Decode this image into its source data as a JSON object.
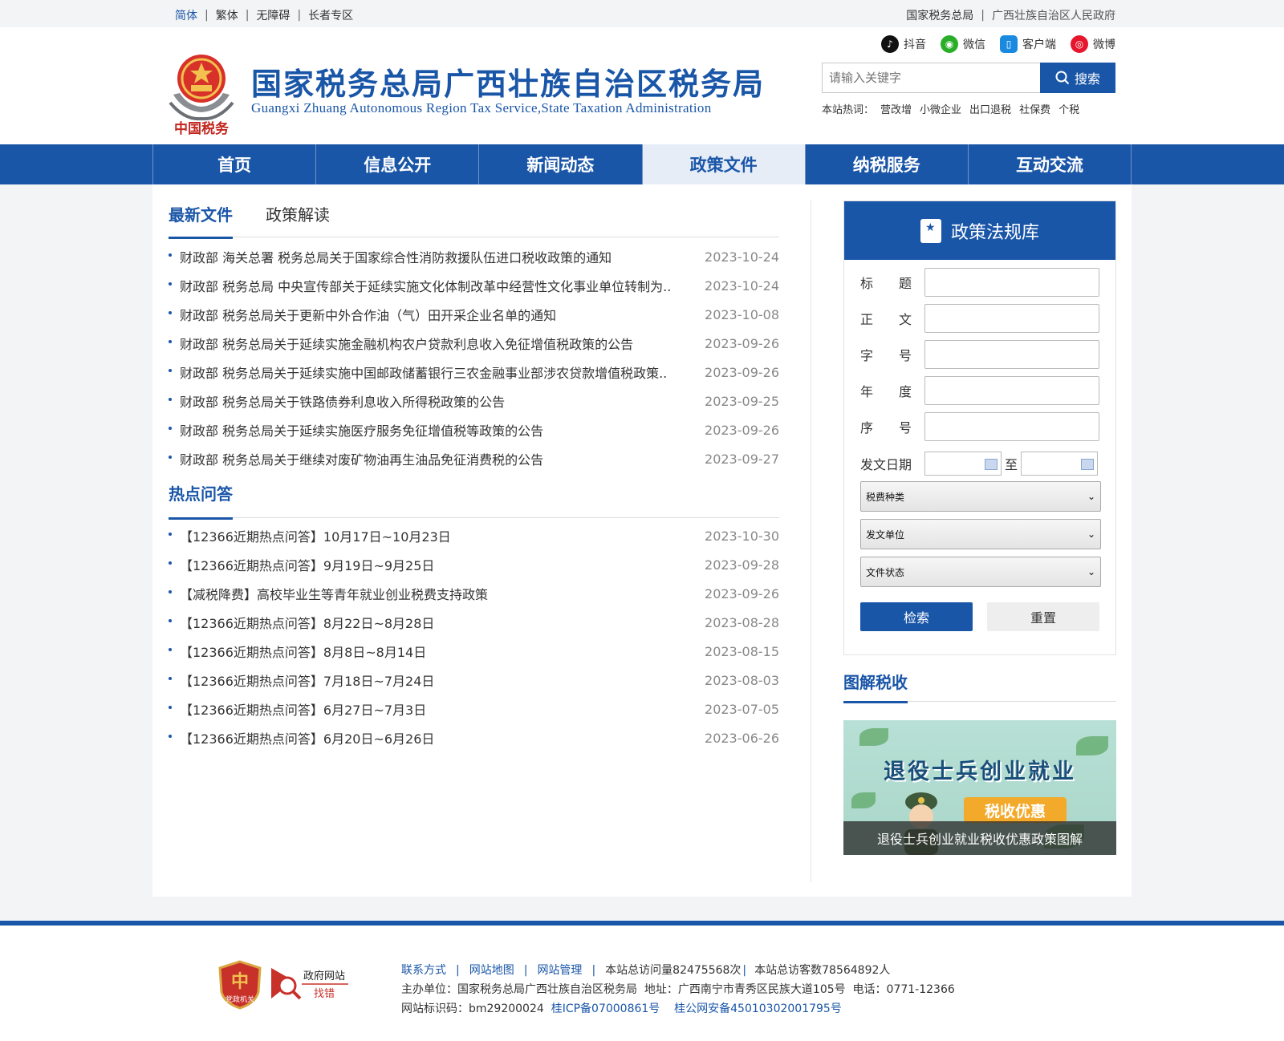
{
  "topbar": {
    "left": [
      "简体",
      "繁体",
      "无障碍",
      "长者专区"
    ],
    "right": [
      "国家税务总局",
      "广西壮族自治区人民政府"
    ]
  },
  "header": {
    "title": "国家税务总局广西壮族自治区税务局",
    "subtitle": "Guangxi Zhuang Autonomous Region Tax Service,State Taxation Administration",
    "emblem_text": "中国税务",
    "social": [
      "抖音",
      "微信",
      "客户端",
      "微博"
    ],
    "search_placeholder": "请输入关键字",
    "search_button": "搜索",
    "hot_label": "本站热词：",
    "hot_words": [
      "营改增",
      "小微企业",
      "出口退税",
      "社保费",
      "个税"
    ]
  },
  "nav": [
    "首页",
    "信息公开",
    "新闻动态",
    "政策文件",
    "纳税服务",
    "互动交流"
  ],
  "nav_active_index": 3,
  "tabs": [
    "最新文件",
    "政策解读"
  ],
  "latest_files": [
    {
      "title": "财政部 海关总署 税务总局关于国家综合性消防救援队伍进口税收政策的通知",
      "date": "2023-10-24"
    },
    {
      "title": "财政部 税务总局 中央宣传部关于延续实施文化体制改革中经营性文化事业单位转制为..",
      "date": "2023-10-24"
    },
    {
      "title": "财政部 税务总局关于更新中外合作油（气）田开采企业名单的通知",
      "date": "2023-10-08"
    },
    {
      "title": "财政部 税务总局关于延续实施金融机构农户贷款利息收入免征增值税政策的公告",
      "date": "2023-09-26"
    },
    {
      "title": "财政部 税务总局关于延续实施中国邮政储蓄银行三农金融事业部涉农贷款增值税政策..",
      "date": "2023-09-26"
    },
    {
      "title": "财政部 税务总局关于铁路债券利息收入所得税政策的公告",
      "date": "2023-09-25"
    },
    {
      "title": "财政部 税务总局关于延续实施医疗服务免征增值税等政策的公告",
      "date": "2023-09-26"
    },
    {
      "title": "财政部 税务总局关于继续对废矿物油再生油品免征消费税的公告",
      "date": "2023-09-27"
    }
  ],
  "hot_qa_title": "热点问答",
  "hot_qa": [
    {
      "title": "【12366近期热点问答】10月17日~10月23日",
      "date": "2023-10-30"
    },
    {
      "title": "【12366近期热点问答】9月19日~9月25日",
      "date": "2023-09-28"
    },
    {
      "title": "【减税降费】高校毕业生等青年就业创业税费支持政策",
      "date": "2023-09-26"
    },
    {
      "title": "【12366近期热点问答】8月22日~8月28日",
      "date": "2023-08-28"
    },
    {
      "title": "【12366近期热点问答】8月8日~8月14日",
      "date": "2023-08-15"
    },
    {
      "title": "【12366近期热点问答】7月18日~7月24日",
      "date": "2023-08-03"
    },
    {
      "title": "【12366近期热点问答】6月27日~7月3日",
      "date": "2023-07-05"
    },
    {
      "title": "【12366近期热点问答】6月20日~6月26日",
      "date": "2023-06-26"
    }
  ],
  "policy_lib": {
    "title": "政策法规库",
    "fields": [
      [
        "标",
        "题"
      ],
      [
        "正",
        "文"
      ],
      [
        "字",
        "号"
      ],
      [
        "年",
        "度"
      ],
      [
        "序",
        "号"
      ]
    ],
    "date_label": "发文日期",
    "date_to": "至",
    "selects": [
      "税费种类",
      "发文单位",
      "文件状态"
    ],
    "search_button": "检索",
    "reset_button": "重置"
  },
  "illustrated": {
    "title": "图解税收",
    "banner_title": "退役士兵创业就业",
    "banner_badge": "税收优惠",
    "caption": "退役士兵创业就业税收优惠政策图解"
  },
  "footer": {
    "links": [
      "联系方式",
      "网站地图",
      "网站管理"
    ],
    "visits": "本站总访问量82475568次",
    "visitors": "本站总访客数78564892人",
    "host": "主办单位：国家税务总局广西壮族自治区税务局",
    "address": "地址：广西南宁市青秀区民族大道105号",
    "phone": "电话：0771-12366",
    "site_id": "网站标识码：bm29200024",
    "icp": "桂ICP备07000861号",
    "police": "桂公网安备45010302001795号",
    "badge1": "党政机关",
    "badge2_line1": "政府网站",
    "badge2_line2": "找错"
  },
  "colors": {
    "brand": "#1a56a8",
    "nav_active_bg": "#e6edf7"
  }
}
